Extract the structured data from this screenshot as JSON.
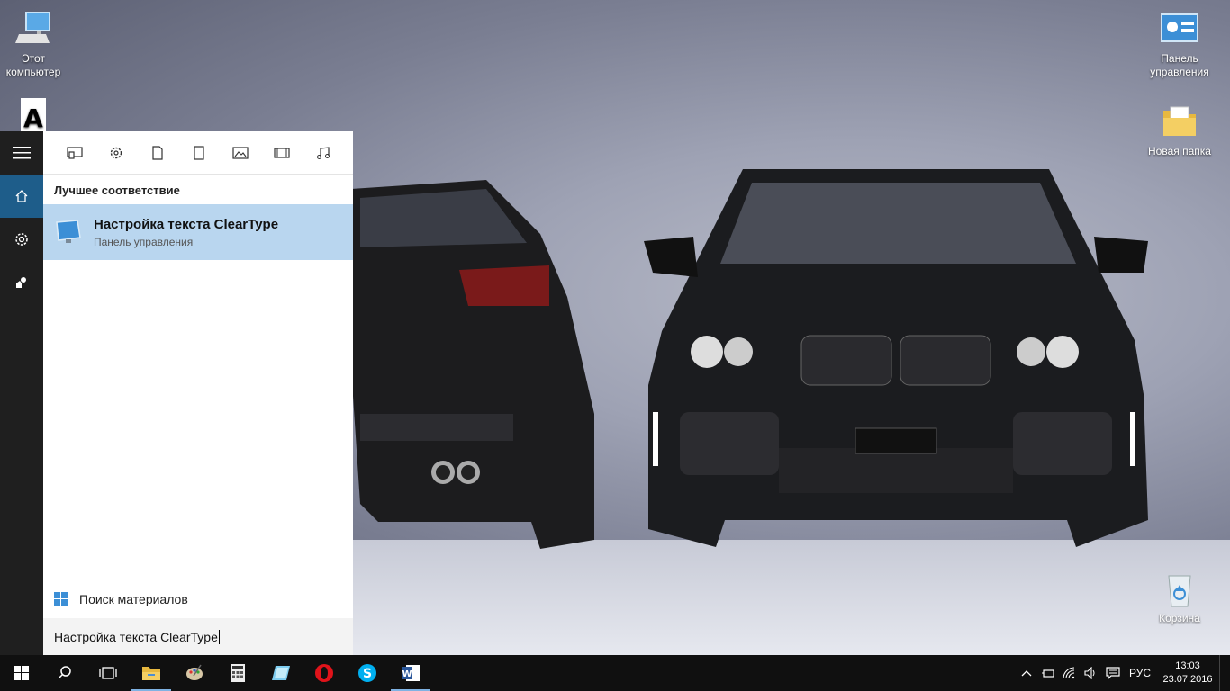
{
  "desktop": {
    "icons": [
      {
        "label": "Этот компьютер",
        "icon": "computer-icon"
      },
      {
        "label": "Панель управления",
        "icon": "control-panel-icon"
      },
      {
        "label": "Новая папка",
        "icon": "folder-icon"
      },
      {
        "label": "Корзина",
        "icon": "recycle-bin-icon"
      }
    ]
  },
  "search": {
    "rail": [
      "hamburger-icon",
      "home-icon",
      "settings-icon",
      "feedback-icon"
    ],
    "filters": [
      "apps-icon",
      "settings-icon",
      "document-icon",
      "tablet-icon",
      "photo-icon",
      "video-icon",
      "music-icon"
    ],
    "section_title": "Лучшее соответствие",
    "best_match": {
      "title": "Настройка текста ClearType",
      "subtitle": "Панель управления"
    },
    "web_search_label": "Поиск материалов",
    "query": "Настройка текста ClearType"
  },
  "taskbar": {
    "language": "РУС",
    "time": "13:03",
    "date": "23.07.2016"
  },
  "colors": {
    "accent": "#1e5d8a",
    "selected": "#b9d6ef",
    "taskbar": "#101010"
  }
}
